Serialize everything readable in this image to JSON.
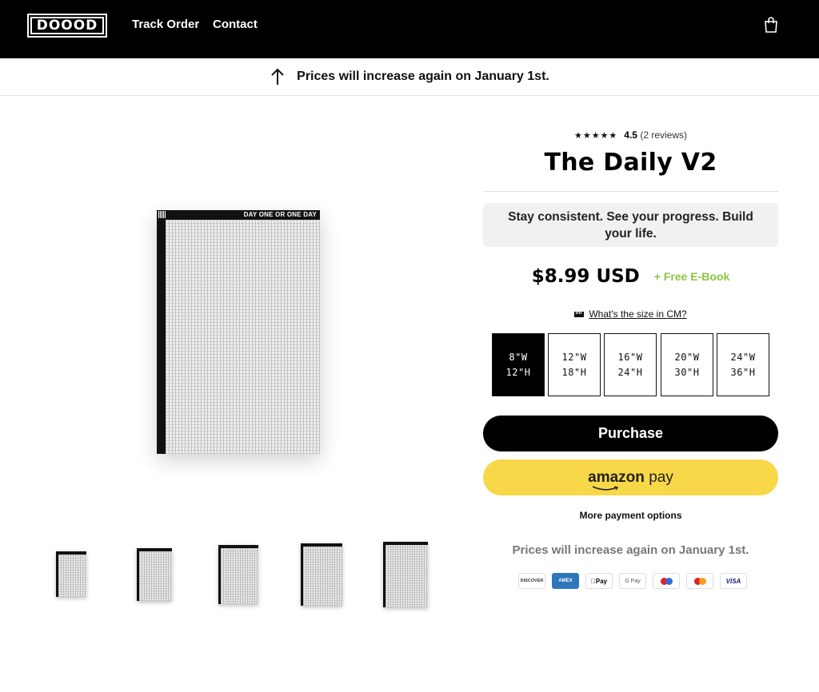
{
  "header": {
    "logo_text": "DOOOD",
    "nav": [
      {
        "label": "Track Order"
      },
      {
        "label": "Contact"
      }
    ],
    "cart_icon": "shopping-bag-icon"
  },
  "announcement": {
    "icon": "arrow-up-icon",
    "text": "Prices will increase again on January 1st."
  },
  "gallery": {
    "main_image_title": "DAY ONE OR ONE DAY",
    "thumbnail_count": 5
  },
  "product": {
    "rating_stars": "★★★★★",
    "rating_score": "4.5",
    "rating_count": "(2 reviews)",
    "title": "The Daily V2",
    "tagline": "Stay consistent. See your progress. Build your life.",
    "price": "$8.99 USD",
    "bonus": "+ Free E-Book",
    "size_help": "What's the size in CM?",
    "sizes": [
      {
        "w": "8\"W",
        "h": "12\"H",
        "selected": true
      },
      {
        "w": "12\"W",
        "h": "18\"H",
        "selected": false
      },
      {
        "w": "16\"W",
        "h": "24\"H",
        "selected": false
      },
      {
        "w": "20\"W",
        "h": "30\"H",
        "selected": false
      },
      {
        "w": "24\"W",
        "h": "36\"H",
        "selected": false
      }
    ],
    "purchase_label": "Purchase",
    "amazon_pay": {
      "brand": "amazon",
      "suffix": "pay"
    },
    "more_payment": "More payment options",
    "price_note": "Prices will increase again on January 1st.",
    "payment_methods": [
      {
        "name": "DISCOVER"
      },
      {
        "name": "AMEX"
      },
      {
        "name": "Pay"
      },
      {
        "name": "G Pay"
      },
      {
        "name": "Maestro"
      },
      {
        "name": "Mastercard"
      },
      {
        "name": "VISA"
      }
    ]
  },
  "colors": {
    "header_bg": "#000000",
    "bonus_green": "#8cc63f",
    "amazon_yellow": "#f8d848"
  }
}
